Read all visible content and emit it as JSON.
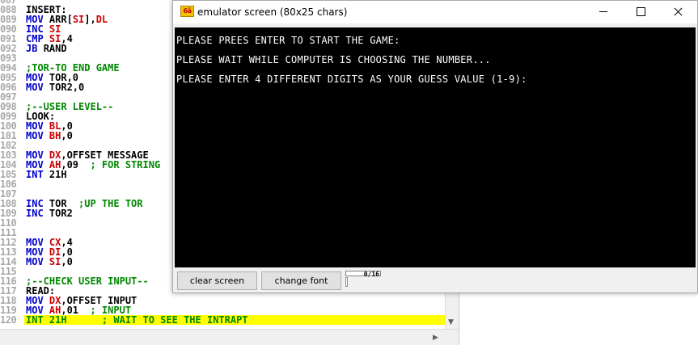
{
  "editor": {
    "line_numbers": [
      "087",
      "088",
      "089",
      "090",
      "091",
      "092",
      "093",
      "094",
      "095",
      "096",
      "097",
      "098",
      "099",
      "100",
      "101",
      "102",
      "103",
      "104",
      "105",
      "106",
      "107",
      "108",
      "109",
      "110",
      "111",
      "112",
      "113",
      "114",
      "115",
      "116",
      "117",
      "118",
      "119",
      "120"
    ],
    "lines": [
      [],
      [
        {
          "t": "INSERT:",
          "c": "nm"
        }
      ],
      [
        {
          "t": "MOV ",
          "c": "kw"
        },
        {
          "t": "ARR[",
          "c": "nm"
        },
        {
          "t": "SI",
          "c": "rg"
        },
        {
          "t": "],",
          "c": "nm"
        },
        {
          "t": "DL",
          "c": "rg"
        }
      ],
      [
        {
          "t": "INC ",
          "c": "kw"
        },
        {
          "t": "SI",
          "c": "rg"
        }
      ],
      [
        {
          "t": "CMP ",
          "c": "kw"
        },
        {
          "t": "SI",
          "c": "rg"
        },
        {
          "t": ",4",
          "c": "nm"
        }
      ],
      [
        {
          "t": "JB ",
          "c": "kw"
        },
        {
          "t": "RAND",
          "c": "nm"
        }
      ],
      [],
      [
        {
          "t": ";TOR-TO END GAME",
          "c": "cm"
        }
      ],
      [
        {
          "t": "MOV ",
          "c": "kw"
        },
        {
          "t": "TOR,0",
          "c": "nm"
        }
      ],
      [
        {
          "t": "MOV ",
          "c": "kw"
        },
        {
          "t": "TOR2,0",
          "c": "nm"
        }
      ],
      [],
      [
        {
          "t": ";--USER LEVEL--",
          "c": "cm"
        }
      ],
      [
        {
          "t": "LOOK:",
          "c": "nm"
        }
      ],
      [
        {
          "t": "MOV ",
          "c": "kw"
        },
        {
          "t": "BL",
          "c": "rg"
        },
        {
          "t": ",0",
          "c": "nm"
        }
      ],
      [
        {
          "t": "MOV ",
          "c": "kw"
        },
        {
          "t": "BH",
          "c": "rg"
        },
        {
          "t": ",0",
          "c": "nm"
        }
      ],
      [],
      [
        {
          "t": "MOV ",
          "c": "kw"
        },
        {
          "t": "DX",
          "c": "rg"
        },
        {
          "t": ",OFFSET MESSAGE",
          "c": "nm"
        }
      ],
      [
        {
          "t": "MOV ",
          "c": "kw"
        },
        {
          "t": "AH",
          "c": "rg"
        },
        {
          "t": ",09  ",
          "c": "nm"
        },
        {
          "t": "; FOR STRING",
          "c": "cm"
        }
      ],
      [
        {
          "t": "INT ",
          "c": "kw"
        },
        {
          "t": "21H",
          "c": "nm"
        }
      ],
      [],
      [],
      [
        {
          "t": "INC ",
          "c": "kw"
        },
        {
          "t": "TOR  ",
          "c": "nm"
        },
        {
          "t": ";UP THE TOR",
          "c": "cm"
        }
      ],
      [
        {
          "t": "INC ",
          "c": "kw"
        },
        {
          "t": "TOR2",
          "c": "nm"
        }
      ],
      [],
      [],
      [
        {
          "t": "MOV ",
          "c": "kw"
        },
        {
          "t": "CX",
          "c": "rg"
        },
        {
          "t": ",4",
          "c": "nm"
        }
      ],
      [
        {
          "t": "MOV ",
          "c": "kw"
        },
        {
          "t": "DI",
          "c": "rg"
        },
        {
          "t": ",0",
          "c": "nm"
        }
      ],
      [
        {
          "t": "MOV ",
          "c": "kw"
        },
        {
          "t": "SI",
          "c": "rg"
        },
        {
          "t": ",0",
          "c": "nm"
        }
      ],
      [],
      [
        {
          "t": ";--CHECK USER INPUT--",
          "c": "cm"
        }
      ],
      [
        {
          "t": "READ:",
          "c": "nm"
        }
      ],
      [
        {
          "t": "MOV ",
          "c": "kw"
        },
        {
          "t": "DX",
          "c": "rg"
        },
        {
          "t": ",OFFSET INPUT",
          "c": "nm"
        }
      ],
      [
        {
          "t": "MOV ",
          "c": "kw"
        },
        {
          "t": "AH",
          "c": "rg"
        },
        {
          "t": ",01  ",
          "c": "nm"
        },
        {
          "t": "; INPUT",
          "c": "cm"
        }
      ],
      [
        {
          "t": "INT 21H      ; WAIT TO SEE THE INTRAPT",
          "c": "cm"
        }
      ]
    ],
    "highlighted_line_index": 33,
    "colors": {
      "keyword": "#0000cc",
      "register": "#cc0000",
      "comment": "#008800",
      "highlight": "#ffff00"
    }
  },
  "emulator": {
    "icon_label": "6å",
    "title": "emulator screen (80x25 chars)",
    "screen_lines": [
      "PLEASE PREES ENTER TO START THE GAME:",
      "PLEASE WAIT WHILE COMPUTER IS CHOOSING THE NUMBER...",
      "PLEASE ENTER 4 DIFFERENT DIGITS AS YOUR GUESS VALUE (1-9):"
    ],
    "clear_label": "clear screen",
    "font_label": "change font",
    "counter": "0/16"
  }
}
